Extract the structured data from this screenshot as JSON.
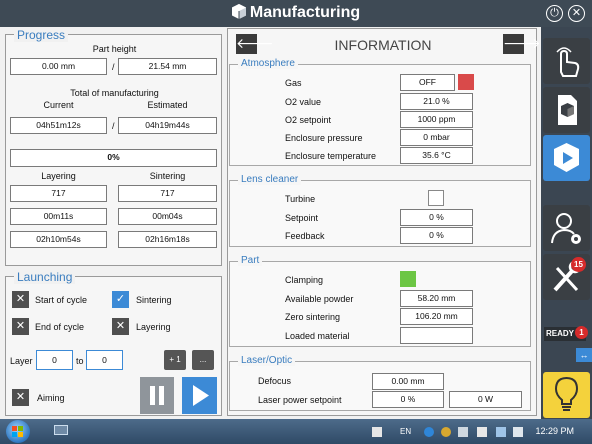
{
  "window": {
    "title": "Manufacturing"
  },
  "progress": {
    "legend": "Progress",
    "part_height_label": "Part height",
    "part_height_current": "0.00 mm",
    "separator": "/",
    "part_height_total": "21.54 mm",
    "total_label": "Total of manufacturing",
    "current_label": "Current",
    "estimated_label": "Estimated",
    "total_current": "04h51m12s",
    "total_estimated": "04h19m44s",
    "percent": "0%",
    "layering_label": "Layering",
    "sintering_label": "Sintering",
    "layering_values": [
      "717",
      "00m11s",
      "02h10m54s"
    ],
    "sintering_values": [
      "717",
      "00m04s",
      "02h16m18s"
    ]
  },
  "launching": {
    "legend": "Launching",
    "start_of_cycle": "Start of cycle",
    "end_of_cycle": "End of cycle",
    "sintering": "Sintering",
    "layering": "Layering",
    "layer_label": "Layer",
    "layer_from": "0",
    "to_label": "to",
    "layer_to": "0",
    "plus_one": "+ 1",
    "ellipsis": "...",
    "aiming": "Aiming"
  },
  "information": {
    "title": "INFORMATION",
    "atmosphere": {
      "legend": "Atmosphere",
      "gas_label": "Gas",
      "gas_value": "OFF",
      "o2_value_label": "O2 value",
      "o2_value": "21.0 %",
      "o2_setpoint_label": "O2 setpoint",
      "o2_setpoint": "1000 ppm",
      "enclosure_pressure_label": "Enclosure pressure",
      "enclosure_pressure": "0 mbar",
      "enclosure_temp_label": "Enclosure temperature",
      "enclosure_temp": "35.6 °C"
    },
    "lens_cleaner": {
      "legend": "Lens cleaner",
      "turbine_label": "Turbine",
      "setpoint_label": "Setpoint",
      "setpoint": "0 %",
      "feedback_label": "Feedback",
      "feedback": "0 %"
    },
    "part": {
      "legend": "Part",
      "clamping_label": "Clamping",
      "available_powder_label": "Available powder",
      "available_powder": "58.20 mm",
      "zero_sintering_label": "Zero sintering",
      "zero_sintering": "106.20 mm",
      "loaded_material_label": "Loaded material",
      "loaded_material": ""
    },
    "laser_optic": {
      "legend": "Laser/Optic",
      "defocus_label": "Defocus",
      "defocus": "0.00 mm",
      "laser_power_label": "Laser power setpoint",
      "laser_power_pct": "0 %",
      "laser_power_w": "0 W"
    }
  },
  "sidebar": {
    "settings_badge": "15",
    "ready_label": "READY",
    "ready_badge": "1"
  },
  "taskbar": {
    "lang": "EN",
    "clock": "12:29 PM"
  },
  "colors": {
    "accent": "#3c8ad6",
    "gas_off": "#d94a4a",
    "clamping_on": "#6cc644",
    "title_bar": "#3e4a55"
  }
}
